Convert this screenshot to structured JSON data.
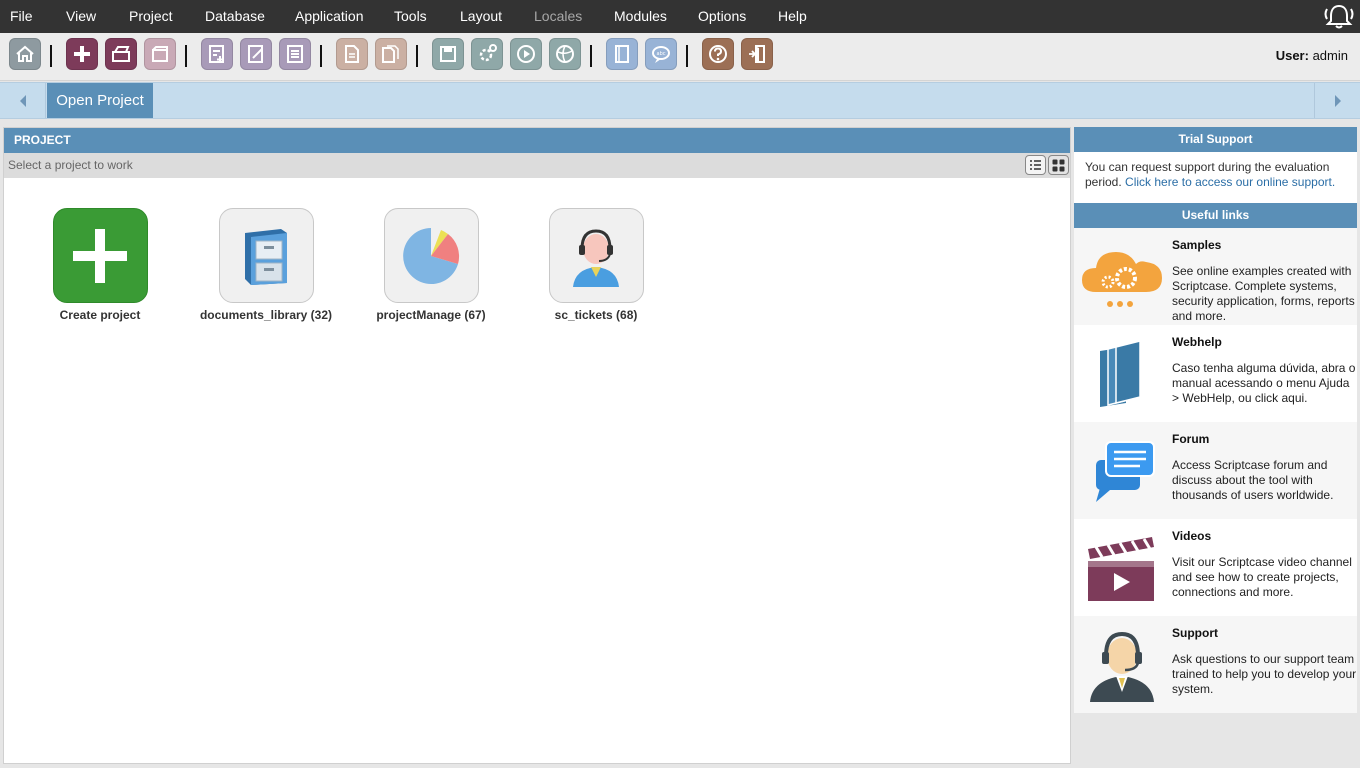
{
  "menu": {
    "items": [
      {
        "label": "File",
        "enabled": true
      },
      {
        "label": "View",
        "enabled": true
      },
      {
        "label": "Project",
        "enabled": true
      },
      {
        "label": "Database",
        "enabled": true
      },
      {
        "label": "Application",
        "enabled": true
      },
      {
        "label": "Tools",
        "enabled": true
      },
      {
        "label": "Layout",
        "enabled": true
      },
      {
        "label": "Locales",
        "enabled": false
      },
      {
        "label": "Modules",
        "enabled": true
      },
      {
        "label": "Options",
        "enabled": true
      },
      {
        "label": "Help",
        "enabled": true
      }
    ],
    "notification_icon": "bell-icon"
  },
  "toolbar": {
    "buttons": [
      {
        "icon": "home-icon",
        "color": "#8e9aa0"
      },
      {
        "icon": "new-project-icon",
        "color": "#7d3b5a"
      },
      {
        "icon": "open-project-icon",
        "color": "#7d3b5a"
      },
      {
        "icon": "project-box-icon",
        "color": "#c9a9b6"
      },
      {
        "icon": "new-application-icon",
        "color": "#a89ab8"
      },
      {
        "icon": "edit-application-icon",
        "color": "#a89ab8"
      },
      {
        "icon": "application-list-icon",
        "color": "#a89ab8"
      },
      {
        "icon": "document-icon",
        "color": "#cbb0a3"
      },
      {
        "icon": "documents-icon",
        "color": "#cbb0a3"
      },
      {
        "icon": "save-icon",
        "color": "#8fa8a8"
      },
      {
        "icon": "generate-icon",
        "color": "#8fa8a8"
      },
      {
        "icon": "run-icon",
        "color": "#8fa8a8"
      },
      {
        "icon": "publish-icon",
        "color": "#8fa8a8"
      },
      {
        "icon": "manual-icon",
        "color": "#98b3d6"
      },
      {
        "icon": "spellcheck-icon",
        "color": "#98b3d6"
      },
      {
        "icon": "help-icon",
        "color": "#9c6f55"
      },
      {
        "icon": "exit-icon",
        "color": "#9c6f55"
      }
    ],
    "user_label": "User:",
    "user_name": "admin"
  },
  "tabs": {
    "open_label": "Open Project"
  },
  "project_panel": {
    "header": "PROJECT",
    "subtitle": "Select a project to work",
    "projects": [
      {
        "label": "Create project",
        "icon": "plus-icon"
      },
      {
        "label": "documents_library (32)",
        "icon": "file-cabinet-icon"
      },
      {
        "label": "projectManage (67)",
        "icon": "pie-chart-icon"
      },
      {
        "label": "sc_tickets (68)",
        "icon": "support-agent-icon"
      }
    ]
  },
  "trial_support": {
    "header": "Trial Support",
    "text": "You can request support during the evaluation period.",
    "link": "Click here to access our online support."
  },
  "useful_links": {
    "header": "Useful links",
    "items": [
      {
        "title": "Samples",
        "description": "See online examples created with Scriptcase. Complete systems, security application, forms, reports and more.",
        "icon": "cloud-gear-icon"
      },
      {
        "title": "Webhelp",
        "description": "Caso tenha alguma dúvida, abra o manual acessando o menu Ajuda > WebHelp, ou click aqui.",
        "icon": "books-icon"
      },
      {
        "title": "Forum",
        "description": "Access Scriptcase forum and discuss about the tool with thousands of users worldwide.",
        "icon": "chat-bubbles-icon"
      },
      {
        "title": "Videos",
        "description": "Visit our Scriptcase video channel and see how to create projects, connections and more.",
        "icon": "clapperboard-icon"
      },
      {
        "title": "Support",
        "description": "Ask questions to our support team trained to help you to develop your system.",
        "icon": "headset-icon"
      }
    ]
  },
  "colors": {
    "menubar": "#333333",
    "accent_blue": "#5a8fb7",
    "tabbar": "#c5dced",
    "create_green": "#3a9b35"
  }
}
